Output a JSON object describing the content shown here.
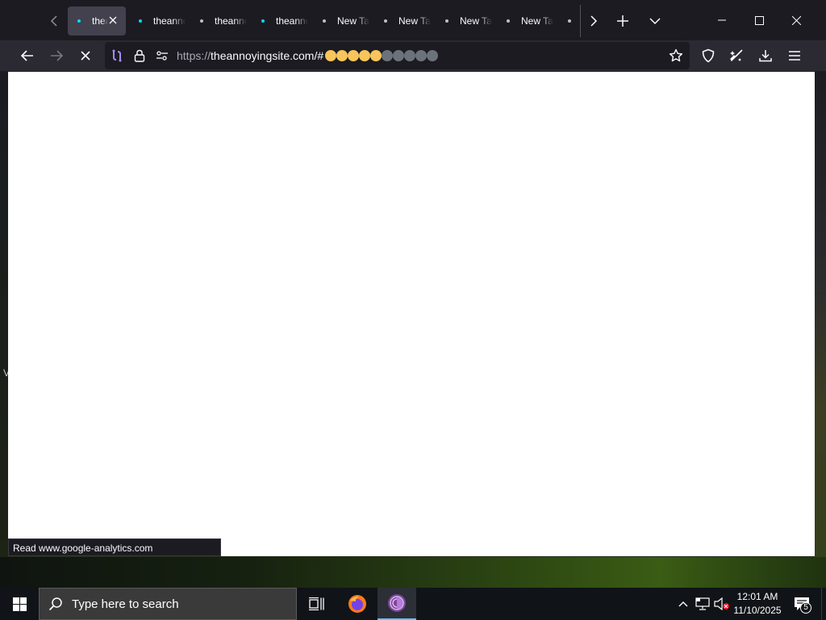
{
  "browser": {
    "tabs": [
      {
        "label": "theannoyingsite.com",
        "active": true,
        "dot": "blue"
      },
      {
        "label": "theannoyingsite.com",
        "active": false,
        "dot": "blue"
      },
      {
        "label": "theannoyingsite.com",
        "active": false,
        "dot": "gray"
      },
      {
        "label": "theannoyingsite.com",
        "active": false,
        "dot": "blue"
      },
      {
        "label": "New Tab",
        "active": false,
        "dot": "gray"
      },
      {
        "label": "New Tab",
        "active": false,
        "dot": "gray"
      },
      {
        "label": "New Tab",
        "active": false,
        "dot": "gray"
      },
      {
        "label": "New Tab",
        "active": false,
        "dot": "gray"
      }
    ],
    "url": {
      "scheme": "https://",
      "host_path": "theannoyingsite.com/#",
      "progress_filled": 5,
      "progress_total": 10
    },
    "status_text": "Read www.google-analytics.com",
    "colors": {
      "tab_bar": "#1c1b22",
      "nav_bar": "#2b2a33",
      "url_field": "#1c1b22",
      "progress_full": "#f7c55b",
      "progress_empty": "#6c727a"
    }
  },
  "taskbar": {
    "search_placeholder": "Type here to search",
    "clock_time": "12:01 AM",
    "clock_date": "11/10/2025",
    "notification_count": "5"
  },
  "desktop": {
    "edge_letter": "V"
  }
}
